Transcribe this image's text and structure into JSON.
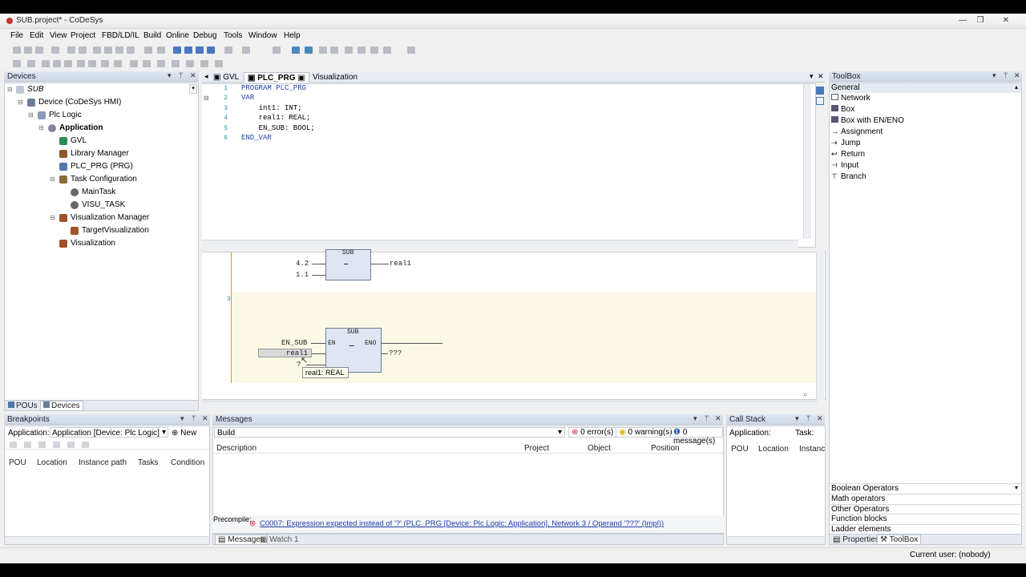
{
  "window": {
    "title": "SUB.project* - CoDeSys",
    "minimize": "—",
    "maximize": "❐",
    "close": "✕"
  },
  "menu": [
    "File",
    "Edit",
    "View",
    "Project",
    "FBD/LD/IL",
    "Build",
    "Online",
    "Debug",
    "Tools",
    "Window",
    "Help"
  ],
  "devices": {
    "header": "Devices",
    "root": "SUB",
    "items": [
      {
        "label": "Device (CoDeSys HMI)",
        "icon": "device-icon",
        "color": "#6b7d99"
      },
      {
        "label": "Plc Logic",
        "icon": "plc-logic-icon",
        "color": "#8a9bb5"
      },
      {
        "label": "Application",
        "icon": "application-icon",
        "color": "#7f8a96"
      },
      {
        "label": "GVL",
        "icon": "gvl-icon",
        "color": "#2e8b57"
      },
      {
        "label": "Library Manager",
        "icon": "library-icon",
        "color": "#8b5a2b"
      },
      {
        "label": "PLC_PRG (PRG)",
        "icon": "pou-icon",
        "color": "#5577aa"
      },
      {
        "label": "Task Configuration",
        "icon": "task-config-icon",
        "color": "#8b6b3a"
      },
      {
        "label": "MainTask",
        "icon": "task-icon",
        "color": "#666666"
      },
      {
        "label": "VISU_TASK",
        "icon": "task-icon",
        "color": "#666666"
      },
      {
        "label": "Visualization Manager",
        "icon": "visu-manager-icon",
        "color": "#a0522d"
      },
      {
        "label": "TargetVisualization",
        "icon": "target-visu-icon",
        "color": "#a0522d"
      },
      {
        "label": "Visualization",
        "icon": "visualization-icon",
        "color": "#a0522d"
      }
    ],
    "bottom_tabs": [
      "POUs",
      "Devices"
    ]
  },
  "editor": {
    "tabs": [
      "GVL",
      "PLC_PRG",
      "Visualization"
    ],
    "code_lines": [
      {
        "n": "1",
        "text": "PROGRAM PLC_PRG"
      },
      {
        "n": "2",
        "text": "VAR"
      },
      {
        "n": "3",
        "text": "    int1: INT;"
      },
      {
        "n": "4",
        "text": "    real1: REAL;"
      },
      {
        "n": "5",
        "text": "    EN_SUB: BOOL;"
      },
      {
        "n": "6",
        "text": "END_VAR"
      }
    ],
    "fbd": {
      "net2": {
        "in1": "4.2",
        "in2": "1.1",
        "title": "SUB",
        "op": "—",
        "out": "real1"
      },
      "net3_label": "3",
      "net3": {
        "en": "EN_SUB",
        "in1": "real1",
        "in2": "?",
        "title": "SUB",
        "en_pin": "EN",
        "eno_pin": "ENO",
        "op": "—",
        "out": "???"
      },
      "tooltip": "real1: REAL"
    }
  },
  "toolbox": {
    "header": "ToolBox",
    "group": "General",
    "items": [
      "Network",
      "Box",
      "Box with EN/ENO",
      "Assignment",
      "Jump",
      "Return",
      "Input",
      "Branch"
    ],
    "categories": [
      "Boolean Operators",
      "Math operators",
      "Other Operators",
      "Function blocks",
      "Ladder elements"
    ],
    "bottom_tabs": [
      "Properties",
      "ToolBox"
    ]
  },
  "breakpoints": {
    "header": "Breakpoints",
    "app_label": "Application:",
    "app_value": "Application [Device: Plc Logic]",
    "new_label": "New",
    "columns": [
      "POU",
      "Location",
      "Instance path",
      "Tasks",
      "Condition"
    ]
  },
  "messages": {
    "header": "Messages",
    "filter": "Build",
    "errors": "0 error(s)",
    "warnings": "0 warning(s)",
    "msgs": "0 message(s)",
    "columns": [
      "Description",
      "Project",
      "Object",
      "Position"
    ],
    "precompile_label": "Precompile:",
    "error_text": "C0007:  Expression expected instead of '?' (PLC_PRG [Device: Plc Logic: Application], Network 3 / Operand '???' (Impl))",
    "bottom_tabs": [
      "Messages",
      "Watch 1"
    ]
  },
  "callstack": {
    "header": "Call Stack",
    "app_label": "Application:",
    "task_label": "Task:",
    "columns": [
      "POU",
      "Location",
      "Instance"
    ]
  },
  "status": {
    "user": "Current user: (nobody)"
  },
  "colors": {
    "accent": "#2b5fb0",
    "error": "#d32f2f",
    "warning": "#e0b000",
    "info": "#2b5fb0",
    "fbd_net_bg": "#fbf9e6"
  }
}
